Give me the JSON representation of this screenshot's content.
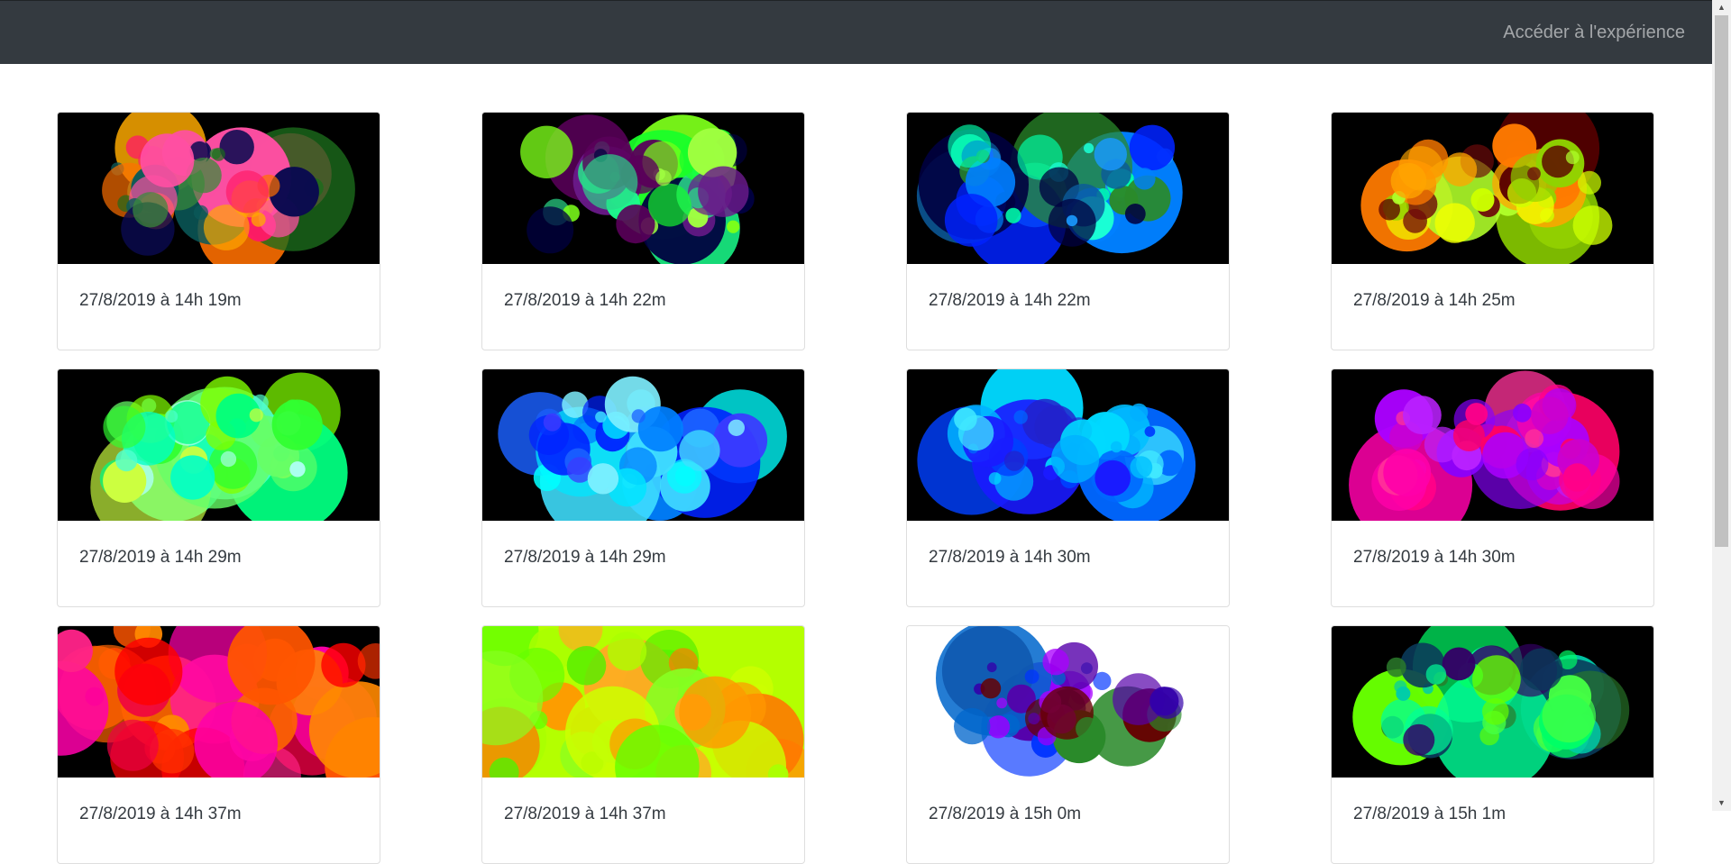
{
  "nav": {
    "link_label": "Accéder à l'expérience"
  },
  "cards": [
    {
      "date": "27/8/2019 à 14h 19m",
      "bg": "#000000",
      "palette": [
        "#ff6f00",
        "#ff1a66",
        "#ffaa00",
        "#0b5a5a",
        "#1b6b1b",
        "#ff4fa3",
        "#0a0a50",
        "#3a8a3a"
      ]
    },
    {
      "date": "27/8/2019 à 14h 22m",
      "bg": "#000000",
      "palette": [
        "#7cff1a",
        "#19ff2a",
        "#1aff8c",
        "#5a005a",
        "#000040",
        "#6a1a8a",
        "#2bd98a",
        "#a0ff40"
      ]
    },
    {
      "date": "27/8/2019 à 14h 22m",
      "bg": "#000000",
      "palette": [
        "#0080ff",
        "#1affd5",
        "#0022ff",
        "#0b5a9a",
        "#2a8a2a",
        "#000040",
        "#1a9aff",
        "#00ffaa"
      ]
    },
    {
      "date": "27/8/2019 à 14h 25m",
      "bg": "#000000",
      "palette": [
        "#f0ff00",
        "#ff7a00",
        "#8fd400",
        "#5a0000",
        "#b0ff2a",
        "#ffa500",
        "#6e0a0a",
        "#ccff00"
      ]
    },
    {
      "date": "27/8/2019 à 14h 29m",
      "bg": "#000000",
      "palette": [
        "#80ff00",
        "#00ff80",
        "#00ffc8",
        "#4fffd0",
        "#ccff40",
        "#66ff66",
        "#aaffee",
        "#30ff30"
      ]
    },
    {
      "date": "27/8/2019 à 14h 29m",
      "bg": "#000000",
      "palette": [
        "#00ffff",
        "#0080ff",
        "#0022ff",
        "#40e0ff",
        "#1a60ff",
        "#00e5ff",
        "#3a3aff",
        "#80f0ff"
      ]
    },
    {
      "date": "27/8/2019 à 14h 30m",
      "bg": "#000000",
      "palette": [
        "#0040ff",
        "#00d9ff",
        "#1a1aff",
        "#00b0ff",
        "#0066ff",
        "#40e8ff",
        "#2222cc",
        "#00c0ff"
      ]
    },
    {
      "date": "27/8/2019 à 14h 30m",
      "bg": "#000000",
      "palette": [
        "#ff00aa",
        "#aa00ff",
        "#ff0066",
        "#cc00cc",
        "#ff3399",
        "#8800ff",
        "#ff0088",
        "#bb22ff"
      ]
    },
    {
      "date": "27/8/2019 à 14h 37m",
      "bg": "#000000",
      "palette": [
        "#ff0000",
        "#ff00aa",
        "#ff6600",
        "#ff3300",
        "#ff2288",
        "#ff8800",
        "#ee0044",
        "#ff5500"
      ]
    },
    {
      "date": "27/8/2019 à 14h 37m",
      "bg": "#b4ff00",
      "palette": [
        "#ff9900",
        "#66ff00",
        "#ccff00",
        "#ff7700",
        "#88ff22",
        "#aaff00",
        "#ffaa22",
        "#55ee00"
      ]
    },
    {
      "date": "27/8/2019 à 15h 0m",
      "bg": "#ffffff",
      "palette": [
        "#0033ff",
        "#5500aa",
        "#9900ff",
        "#660000",
        "#0066cc",
        "#2a8a2a",
        "#3300aa",
        "#aa00ff"
      ]
    },
    {
      "date": "27/8/2019 à 15h 1m",
      "bg": "#000000",
      "palette": [
        "#00ff66",
        "#66ff00",
        "#00ccaa",
        "#0a3a5a",
        "#2a7a2a",
        "#00ff99",
        "#330066",
        "#44ff44"
      ]
    }
  ]
}
